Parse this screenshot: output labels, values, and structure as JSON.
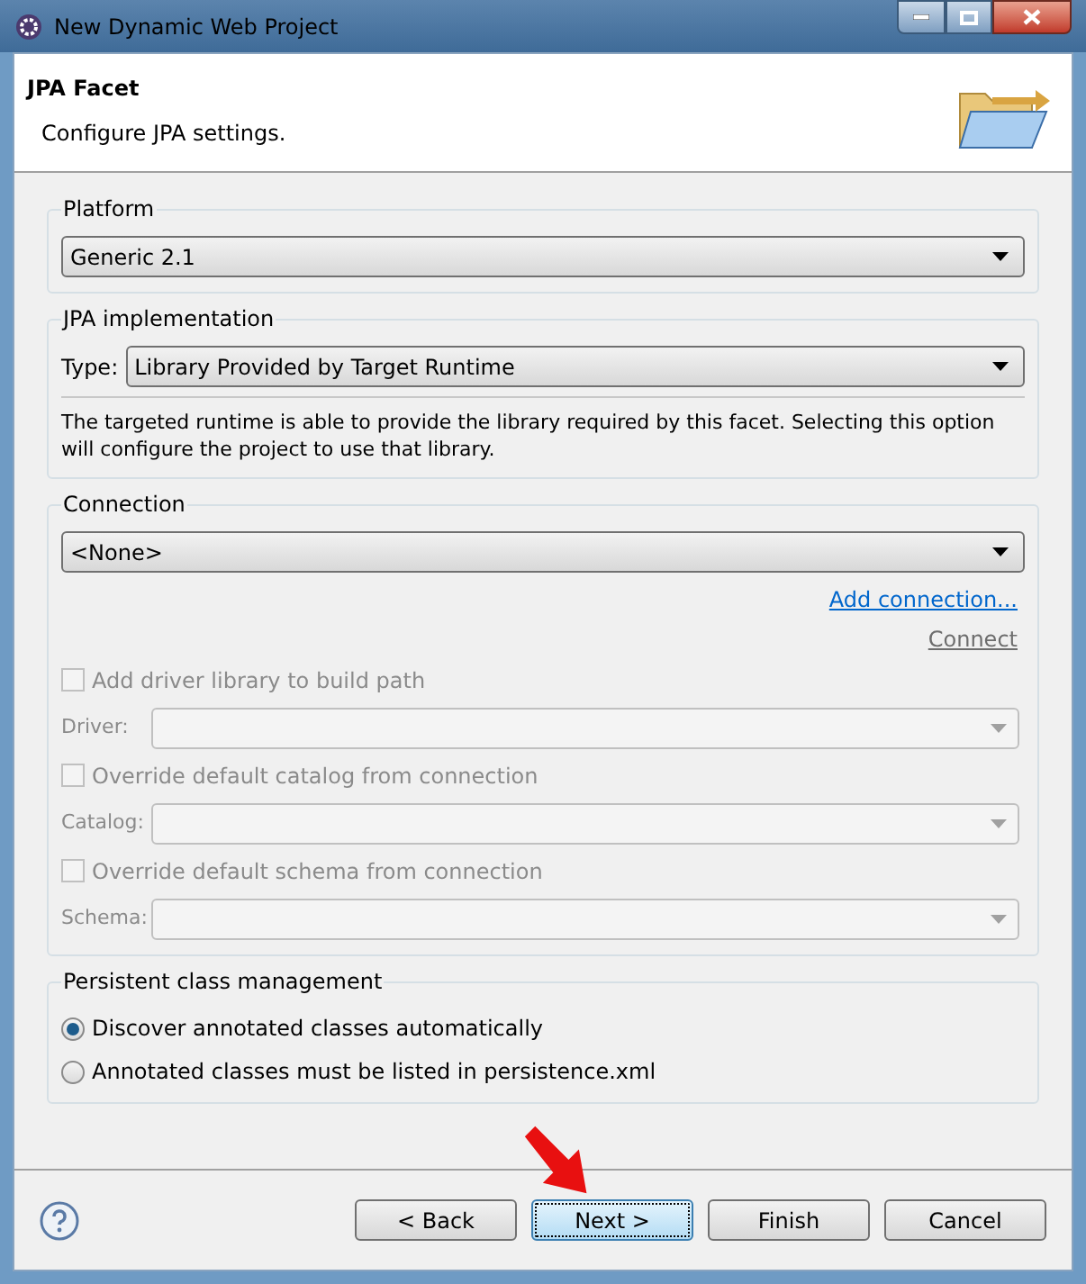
{
  "window": {
    "title": "New Dynamic Web Project"
  },
  "header": {
    "title": "JPA Facet",
    "description": "Configure JPA settings."
  },
  "platform": {
    "label": "Platform",
    "value": "Generic 2.1"
  },
  "jpa_implementation": {
    "label": "JPA implementation",
    "type_label": "Type:",
    "type_value": "Library Provided by Target Runtime",
    "description": "The targeted runtime is able to provide the library required by this facet. Selecting this option will configure the project to use that library."
  },
  "connection": {
    "label": "Connection",
    "value": "<None>",
    "add_link": "Add connection...",
    "connect_link": "Connect",
    "rows": [
      {
        "kind": "checkbox",
        "label": "Add driver library to build path",
        "checked": false,
        "disabled": true
      },
      {
        "kind": "combo",
        "label": "Driver:",
        "disabled": true
      },
      {
        "kind": "checkbox",
        "label": "Override default catalog from connection",
        "checked": false,
        "disabled": true
      },
      {
        "kind": "combo",
        "label": "Catalog:",
        "disabled": true
      },
      {
        "kind": "checkbox",
        "label": "Override default schema from connection",
        "checked": false,
        "disabled": true
      },
      {
        "kind": "combo",
        "label": "Schema:",
        "disabled": true
      }
    ]
  },
  "persistent_class_management": {
    "label": "Persistent class management",
    "options": [
      {
        "label": "Discover annotated classes automatically",
        "selected": true
      },
      {
        "label": "Annotated classes must be listed in persistence.xml",
        "selected": false
      }
    ]
  },
  "buttons": [
    {
      "label": "< Back",
      "focused": false
    },
    {
      "label": "Next >",
      "focused": true
    },
    {
      "label": "Finish",
      "focused": false
    },
    {
      "label": "Cancel",
      "focused": false
    }
  ]
}
